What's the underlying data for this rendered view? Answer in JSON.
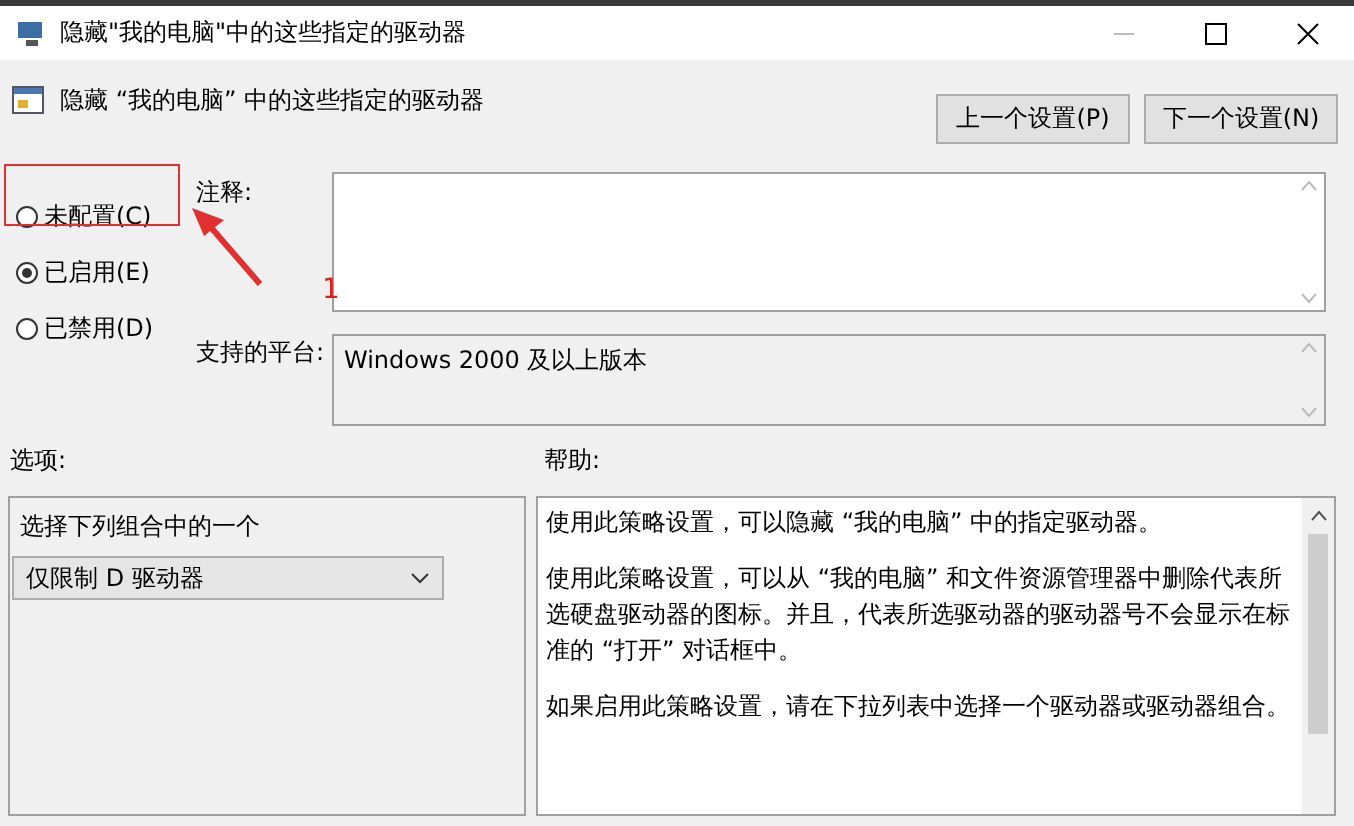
{
  "window": {
    "title": "隐藏\"我的电脑\"中的这些指定的驱动器"
  },
  "header": {
    "title": "隐藏 “我的电脑” 中的这些指定的驱动器",
    "buttons": [
      "上一个设置(P)",
      "下一个设置(N)"
    ]
  },
  "radios": [
    {
      "label": "未配置(C)",
      "selected": false
    },
    {
      "label": "已启用(E)",
      "selected": true
    },
    {
      "label": "已禁用(D)",
      "selected": false
    }
  ],
  "annotation": {
    "number": "1"
  },
  "comment": {
    "label": "注释:"
  },
  "platform": {
    "label": "支持的平台:",
    "value": "Windows 2000 及以上版本"
  },
  "options": {
    "label": "选项:",
    "prompt": "选择下列组合中的一个",
    "dropdown": "仅限制 D 驱动器"
  },
  "help": {
    "label": "帮助:",
    "paragraphs": [
      "使用此策略设置，可以隐藏 “我的电脑” 中的指定驱动器。",
      "使用此策略设置，可以从 “我的电脑” 和文件资源管理器中删除代表所选硬盘驱动器的图标。并且，代表所选驱动器的驱动器号不会显示在标准的 “打开” 对话框中。",
      "如果启用此策略设置，请在下拉列表中选择一个驱动器或驱动器组合。"
    ]
  }
}
